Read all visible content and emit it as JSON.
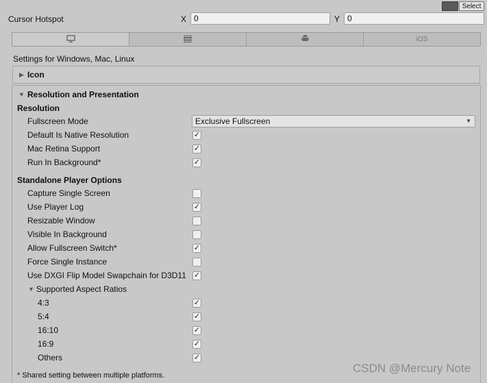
{
  "top": {
    "select_label": "Select"
  },
  "cursor_hotspot": {
    "label": "Cursor Hotspot",
    "x_label": "X",
    "x_value": "0",
    "y_label": "Y",
    "y_value": "0"
  },
  "tabs": [
    {
      "icon": "monitor-icon",
      "label": ""
    },
    {
      "icon": "server-icon",
      "label": ""
    },
    {
      "icon": "android-icon",
      "label": ""
    },
    {
      "icon": "",
      "label": "iOS"
    }
  ],
  "settings_header": "Settings for Windows, Mac, Linux",
  "icon_section": {
    "title": "Icon"
  },
  "resolution_presentation": {
    "title": "Resolution and Presentation",
    "resolution_heading": "Resolution",
    "fullscreen_mode_label": "Fullscreen Mode",
    "fullscreen_mode_value": "Exclusive Fullscreen",
    "resolution_items": [
      {
        "label": "Default Is Native Resolution",
        "checked": true
      },
      {
        "label": "Mac Retina Support",
        "checked": true
      },
      {
        "label": "Run In Background*",
        "checked": true
      }
    ],
    "standalone_heading": "Standalone Player Options",
    "standalone_items": [
      {
        "label": "Capture Single Screen",
        "checked": false
      },
      {
        "label": "Use Player Log",
        "checked": true
      },
      {
        "label": "Resizable Window",
        "checked": false
      },
      {
        "label": "Visible In Background",
        "checked": false
      },
      {
        "label": "Allow Fullscreen Switch*",
        "checked": true
      },
      {
        "label": "Force Single Instance",
        "checked": false
      },
      {
        "label": "Use DXGI Flip Model Swapchain for D3D11",
        "checked": true
      }
    ],
    "aspect_ratios_label": "Supported Aspect Ratios",
    "aspect_ratios": [
      {
        "label": "4:3",
        "checked": true
      },
      {
        "label": "5:4",
        "checked": true
      },
      {
        "label": "16:10",
        "checked": true
      },
      {
        "label": "16:9",
        "checked": true
      },
      {
        "label": "Others",
        "checked": true
      }
    ]
  },
  "footnote": "* Shared setting between multiple platforms.",
  "watermark": "CSDN @Mercury Note",
  "colors": {
    "background": "#c8c8c8",
    "field": "#f0f0f0",
    "border": "#9e9e9e"
  }
}
